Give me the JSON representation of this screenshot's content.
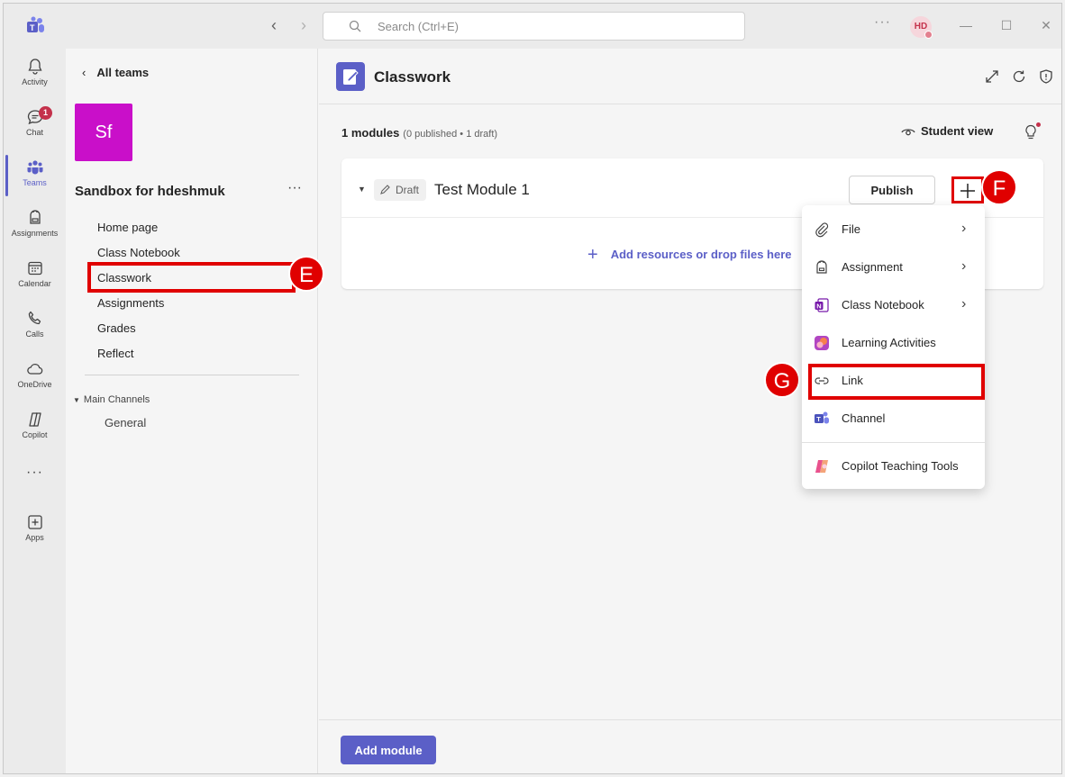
{
  "titlebar": {
    "search_placeholder": "Search (Ctrl+E)",
    "more": "···",
    "avatar_initials": "HD"
  },
  "rail": {
    "items": [
      {
        "label": "Activity",
        "icon": "bell-icon"
      },
      {
        "label": "Chat",
        "icon": "chat-icon",
        "badge": "1"
      },
      {
        "label": "Teams",
        "icon": "teams-icon",
        "active": true
      },
      {
        "label": "Assignments",
        "icon": "backpack-icon"
      },
      {
        "label": "Calendar",
        "icon": "calendar-icon"
      },
      {
        "label": "Calls",
        "icon": "phone-icon"
      },
      {
        "label": "OneDrive",
        "icon": "cloud-icon"
      },
      {
        "label": "Copilot",
        "icon": "copilot-icon"
      },
      {
        "label": "Apps",
        "icon": "plus-square-icon"
      }
    ],
    "more": "···"
  },
  "team": {
    "back_label": "All teams",
    "avatar_initials": "Sf",
    "name": "Sandbox for hdeshmuk",
    "more": "···",
    "nav": [
      "Home page",
      "Class Notebook",
      "Classwork",
      "Assignments",
      "Grades",
      "Reflect"
    ],
    "channels_header": "Main Channels",
    "channels": [
      "General"
    ]
  },
  "main": {
    "title": "Classwork",
    "modules_count": "1 modules",
    "modules_detail": "(0 published • 1 draft)",
    "student_view": "Student view",
    "module": {
      "status": "Draft",
      "title": "Test Module 1",
      "publish_label": "Publish",
      "add_resources": "Add resources or drop files here"
    },
    "add_module": "Add module"
  },
  "menu": {
    "items": [
      {
        "label": "File",
        "icon": "paperclip-icon",
        "submenu": true
      },
      {
        "label": "Assignment",
        "icon": "backpack-icon",
        "submenu": true
      },
      {
        "label": "Class Notebook",
        "icon": "onenote-icon",
        "submenu": true
      },
      {
        "label": "Learning Activities",
        "icon": "learning-activities-icon",
        "submenu": false
      },
      {
        "label": "Link",
        "icon": "link-icon",
        "submenu": false
      },
      {
        "label": "Channel",
        "icon": "teams-channel-icon",
        "submenu": false
      },
      {
        "label": "Copilot Teaching Tools",
        "icon": "copilot-teaching-icon",
        "submenu": false
      }
    ]
  },
  "markers": {
    "e": "E",
    "f": "F",
    "g": "G"
  },
  "colors": {
    "accent": "#5b5fc7",
    "highlight": "#e00000",
    "team_avatar": "#c90fc9"
  }
}
